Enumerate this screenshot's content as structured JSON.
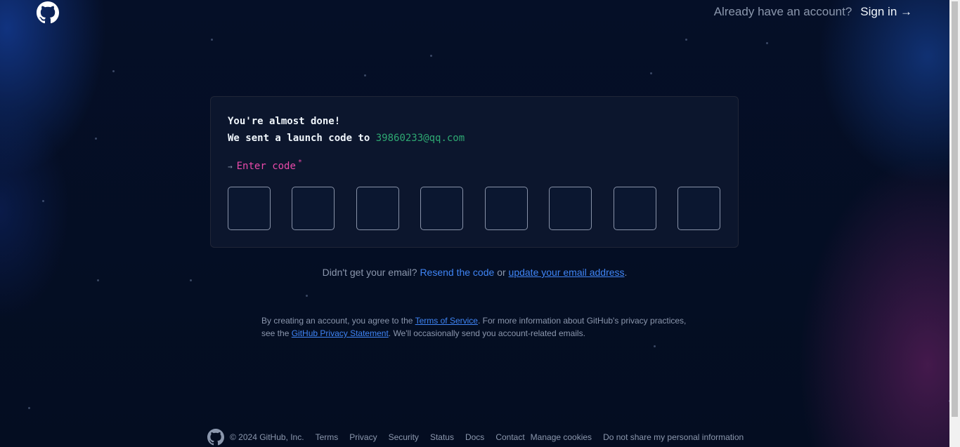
{
  "header": {
    "logo_icon": "github-mark-icon",
    "already_text": "Already have an account?",
    "signin_label": "Sign in →"
  },
  "card": {
    "line1": "You're almost done!",
    "line2_prefix": "We sent a launch code to",
    "email": "39860233@qq.com",
    "code_arrow": "→",
    "code_label": "Enter code",
    "required_mark": "*",
    "code_boxes": [
      "",
      "",
      "",
      "",
      "",
      "",
      "",
      ""
    ]
  },
  "resend": {
    "prefix": "Didn't get your email?",
    "resend_link": "Resend the code",
    "or": "or",
    "update_link": "update your email address",
    "suffix": "."
  },
  "legal": {
    "part1": "By creating an account, you agree to the",
    "tos_link": "Terms of Service",
    "part2": ". For more information about GitHub's privacy practices, see the",
    "privacy_link": "GitHub Privacy Statement",
    "part3": ". We'll occasionally send you account-related emails."
  },
  "footer": {
    "copyright": "© 2024 GitHub, Inc.",
    "links": [
      "Terms",
      "Privacy",
      "Security",
      "Status",
      "Docs",
      "Contact",
      "Manage cookies",
      "Do not share my personal information"
    ]
  },
  "colors": {
    "background": "#040d21",
    "card_bg": "#0c162d",
    "email": "#2ea872",
    "label_pink": "#ea4aaa",
    "link_blue": "#3f85f5"
  }
}
